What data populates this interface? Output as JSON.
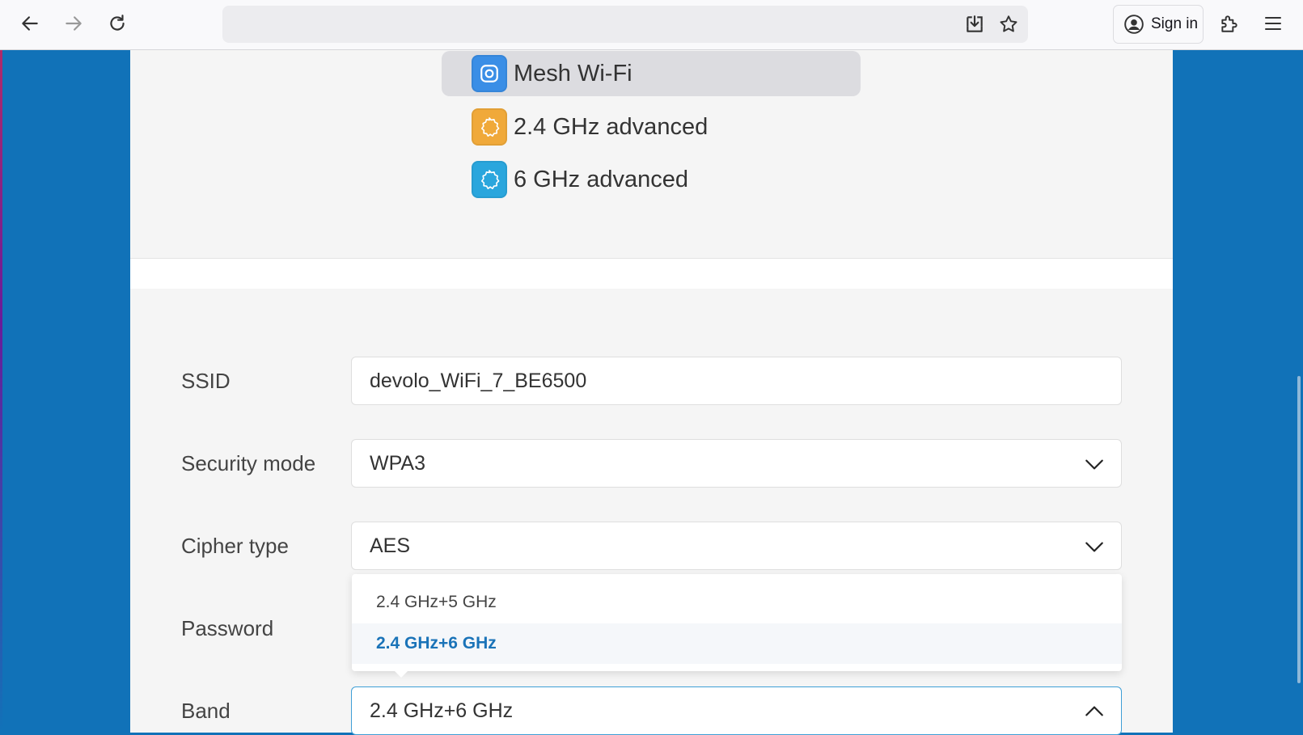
{
  "browser": {
    "signin_label": "Sign in"
  },
  "menu": {
    "items": [
      {
        "label": "Mesh Wi-Fi",
        "icon": "mesh-wifi-icon",
        "color": "#3a8ee6",
        "active": true
      },
      {
        "label": "2.4 GHz advanced",
        "icon": "settings-gear-2-4ghz-icon",
        "color": "#f0a93a",
        "active": false
      },
      {
        "label": "6 GHz advanced",
        "icon": "settings-gear-6ghz-icon",
        "color": "#2aa6dd",
        "active": false
      }
    ]
  },
  "form": {
    "ssid": {
      "label": "SSID",
      "value": "devolo_WiFi_7_BE6500"
    },
    "security_mode": {
      "label": "Security mode",
      "value": "WPA3"
    },
    "cipher_type": {
      "label": "Cipher type",
      "value": "AES"
    },
    "password": {
      "label": "Password"
    },
    "band": {
      "label": "Band",
      "value": "2.4 GHz+6 GHz",
      "options": [
        "2.4 GHz+5 GHz",
        "2.4 GHz+6 GHz"
      ],
      "selected_option": "2.4 GHz+6 GHz"
    }
  },
  "colors": {
    "page_background": "#1172b8",
    "accent": "#1a73b8",
    "focus_border": "#3f9fd6"
  }
}
